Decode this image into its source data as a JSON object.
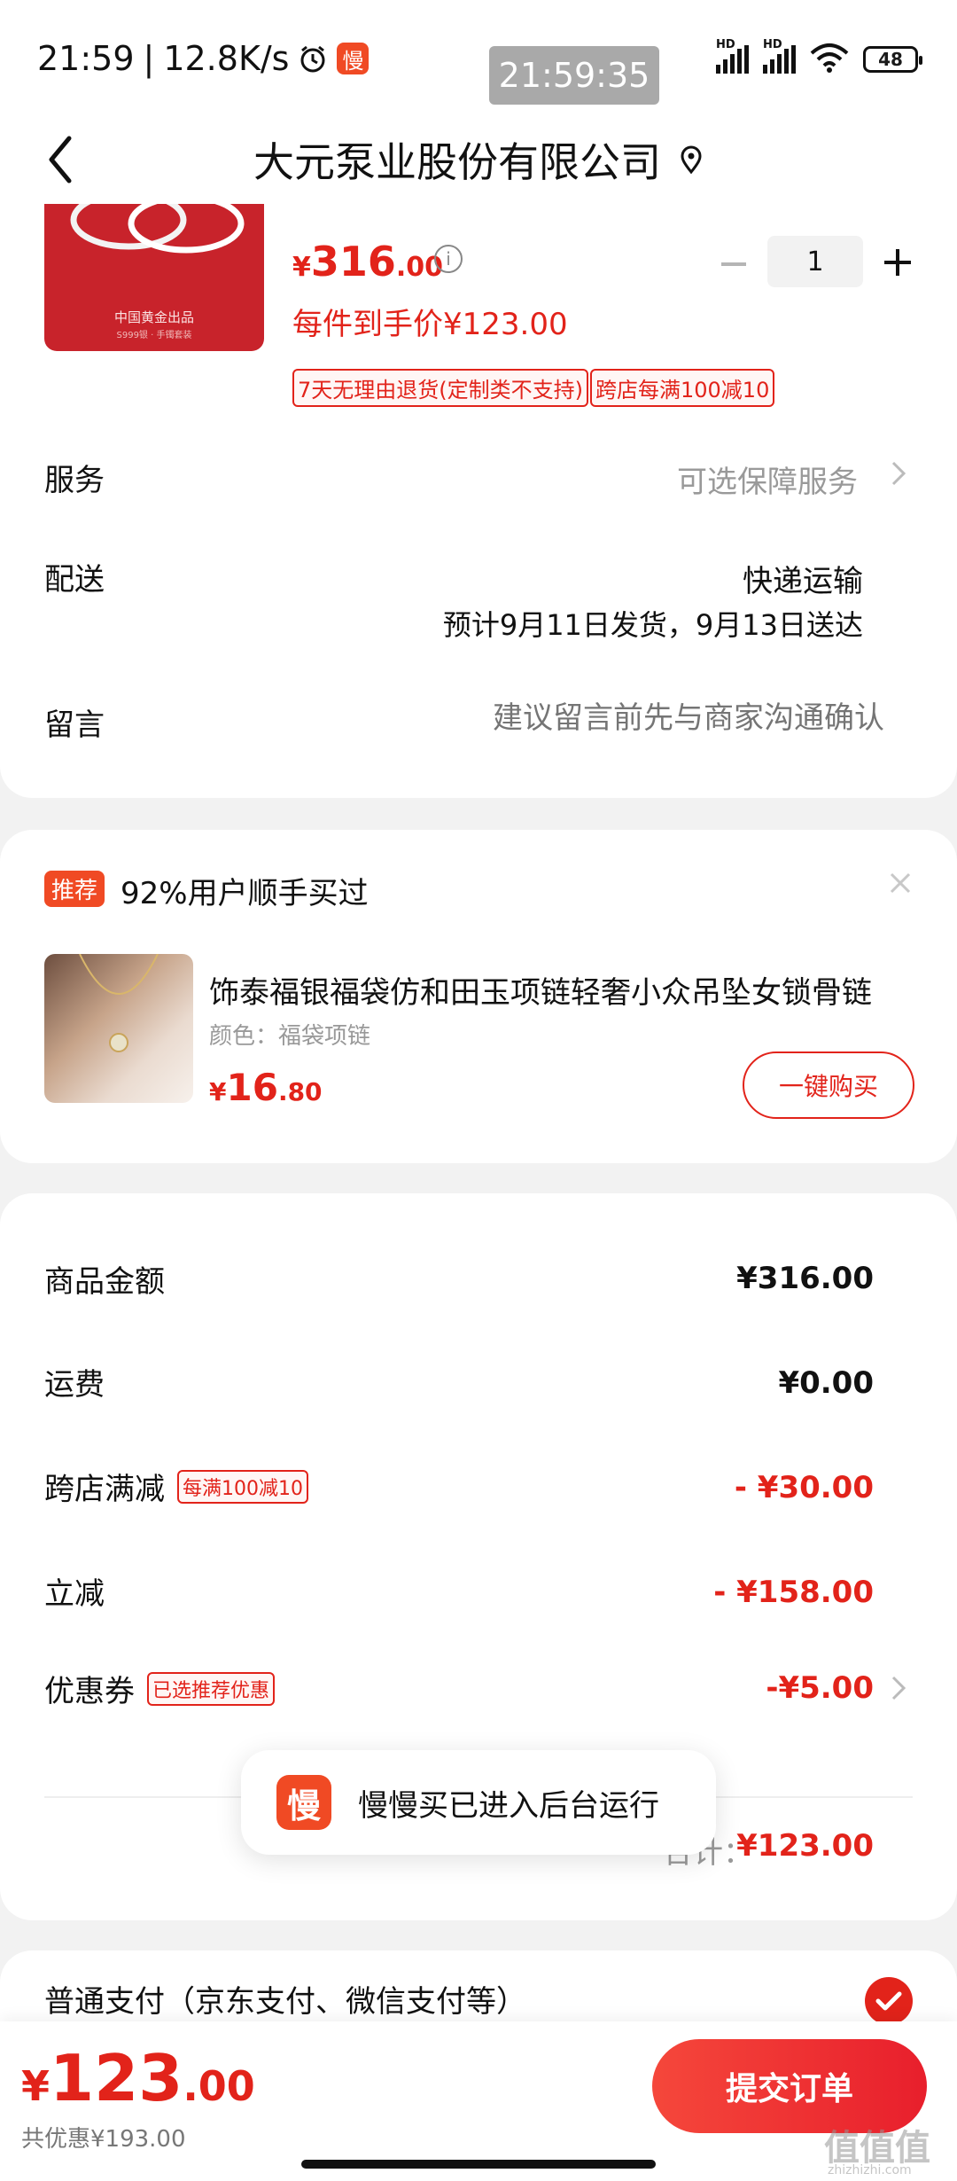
{
  "status_bar": {
    "time": "21:59",
    "net_speed": "12.8K/s",
    "clock_overlay": "21:59:35",
    "battery": "48",
    "app_badge": "慢",
    "signal_label": "HD"
  },
  "header": {
    "title": "大元泵业股份有限公司"
  },
  "product": {
    "thumb_caption": "中国黄金出品",
    "thumb_caption_small": "S999银 · 手镯套装",
    "price_currency": "¥",
    "price_int": "316",
    "price_dec": ".00",
    "info_icon": "i",
    "quantity": "1",
    "unit_price_text": "每件到手价¥123.00",
    "tag_return": "7天无理由退货(定制类不支持)",
    "tag_discount": "跨店每满100减10"
  },
  "service": {
    "label": "服务",
    "value": "可选保障服务"
  },
  "shipping": {
    "label": "配送",
    "method": "快递运输",
    "eta": "预计9月11日发货，9月13日送达"
  },
  "message": {
    "label": "留言",
    "placeholder": "建议留言前先与商家沟通确认"
  },
  "recommend": {
    "badge": "推荐",
    "title": "92%用户顺手买过",
    "item_name": "饰泰福银福袋仿和田玉项链轻奢小众吊坠女锁骨链",
    "item_spec": "颜色：福袋项链",
    "price_currency": "¥",
    "price_int": "16",
    "price_dec": ".80",
    "buy_label": "一键购买"
  },
  "summary": {
    "goods_label": "商品金额",
    "goods_value": "¥316.00",
    "freight_label": "运费",
    "freight_value": "¥0.00",
    "cross_label": "跨店满减",
    "cross_tag": "每满100减10",
    "cross_value": "- ¥30.00",
    "instant_label": "立减",
    "instant_value": "- ¥158.00",
    "coupon_label": "优惠券",
    "coupon_tag": "已选推荐优惠",
    "coupon_value": "-¥5.00",
    "total_label": "合计：",
    "total_value": "¥123.00"
  },
  "toast": {
    "icon": "慢",
    "text": "慢慢买已进入后台运行"
  },
  "payment": {
    "label": "普通支付（京东支付、微信支付等）"
  },
  "bottom": {
    "total_currency": "¥",
    "total_int": "123",
    "total_dec": ".00",
    "saving": "共优惠¥193.00",
    "submit_label": "提交订单"
  },
  "watermark": {
    "text": "值值值",
    "sub": "zhizhizhi.com"
  },
  "colors": {
    "accent": "#e2231a",
    "brand_orange": "#f04a24",
    "muted": "#999999"
  }
}
